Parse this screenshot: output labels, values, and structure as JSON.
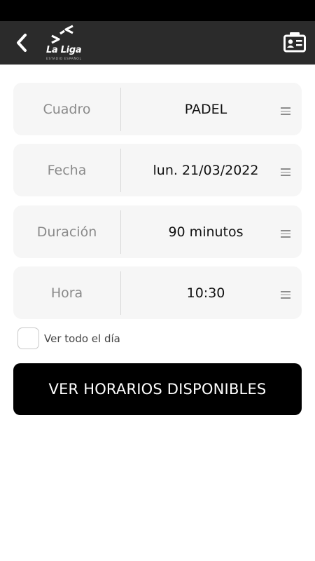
{
  "header": {
    "back_icon": "chevron-left-icon",
    "logo_text": "La Liga",
    "logo_subtext": "ESTADIO ESPAÑOL",
    "card_icon": "id-card-icon"
  },
  "form": {
    "fields": [
      {
        "label": "Cuadro",
        "value": "PADEL"
      },
      {
        "label": "Fecha",
        "value": "lun. 21/03/2022"
      },
      {
        "label": "Duración",
        "value": "90 minutos"
      },
      {
        "label": "Hora",
        "value": "10:30"
      }
    ],
    "all_day_label": "Ver todo el día",
    "all_day_checked": false
  },
  "cta_label": "VER HORARIOS DISPONIBLES",
  "colors": {
    "status_bar": "#000000",
    "header": "#2b2b2b",
    "field_bg": "#f6f6f6",
    "cta_bg": "#000000"
  }
}
